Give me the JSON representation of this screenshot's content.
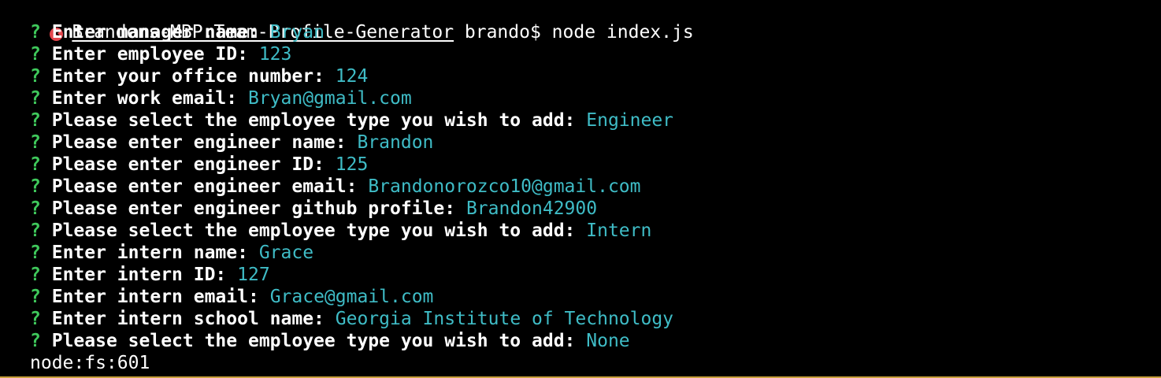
{
  "terminal": {
    "command": {
      "status_icon": "error-x-icon",
      "path": "Brandons-MBP:Team-Profile-Generator",
      "rest": " brando$ node index.js"
    },
    "prompt_symbol": "?",
    "prompts": [
      {
        "question": "Enter manager name:",
        "answer": "Bryan"
      },
      {
        "question": "Enter employee ID:",
        "answer": "123"
      },
      {
        "question": "Enter your office number:",
        "answer": "124"
      },
      {
        "question": "Enter work email:",
        "answer": "Bryan@gmail.com"
      },
      {
        "question": "Please select the employee type you wish to add:",
        "answer": "Engineer"
      },
      {
        "question": "Please enter engineer name:",
        "answer": "Brandon"
      },
      {
        "question": "Please enter engineer ID:",
        "answer": "125"
      },
      {
        "question": "Please enter engineer email:",
        "answer": "Brandonorozco10@gmail.com"
      },
      {
        "question": "Please enter engineer github profile:",
        "answer": "Brandon42900"
      },
      {
        "question": "Please select the employee type you wish to add:",
        "answer": "Intern"
      },
      {
        "question": "Enter intern name:",
        "answer": "Grace"
      },
      {
        "question": "Enter intern ID:",
        "answer": "127"
      },
      {
        "question": "Enter intern email:",
        "answer": "Grace@gmail.com"
      },
      {
        "question": "Enter intern school name:",
        "answer": "Georgia Institute of Technology"
      },
      {
        "question": "Please select the employee type you wish to add:",
        "answer": "None"
      }
    ],
    "output": "node:fs:601",
    "colors": {
      "background": "#000000",
      "prompt_symbol": "#3fc85b",
      "answer": "#3fbcc6",
      "error_icon": "#e5464d"
    }
  }
}
